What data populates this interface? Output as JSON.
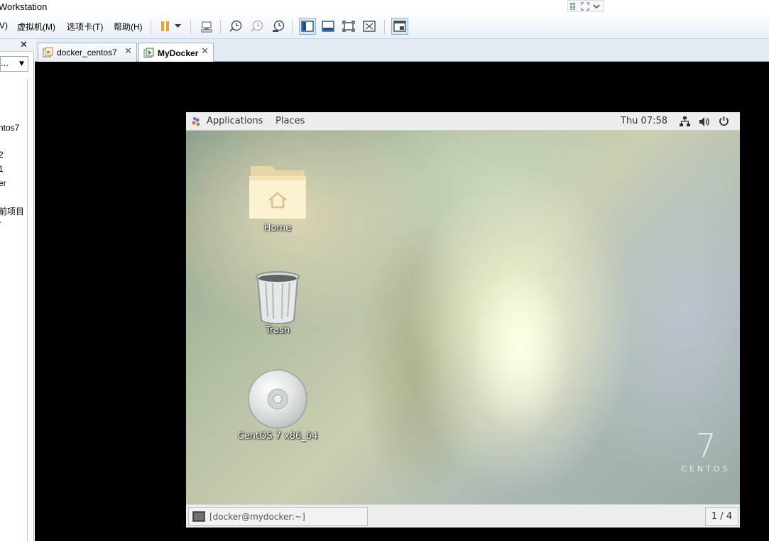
{
  "window": {
    "title": "Workstation"
  },
  "menu": {
    "items": [
      "V)",
      "虚拟机(M)",
      "选项卡(T)",
      "帮助(H)"
    ]
  },
  "toolbar": {
    "icons": [
      "pause-icon",
      "dropdown-arrow-icon",
      "send-ctrl-alt-del-icon",
      "snapshot-take-icon",
      "snapshot-revert-icon",
      "snapshot-manager-icon",
      "view-library-icon",
      "view-thumbnail-icon",
      "fullscreen-icon",
      "unity-icon",
      "console-view-icon"
    ],
    "pause_color": "#e8a23a"
  },
  "library": {
    "close_label": "✕",
    "search_value": "…",
    "tree_items": [
      "ntos7",
      "2",
      "1",
      "er",
      "前项目",
      "-"
    ]
  },
  "tabs": [
    {
      "label": "docker_centos7",
      "close": "✕",
      "active": false
    },
    {
      "label": "MyDocker",
      "close": "✕",
      "active": true
    }
  ],
  "guest": {
    "topbar": {
      "applications": "Applications",
      "places": "Places",
      "clock": "Thu 07:58"
    },
    "desktop_icons": [
      {
        "label": "Home",
        "icon": "home-folder-icon"
      },
      {
        "label": "Trash",
        "icon": "trash-icon"
      },
      {
        "label": "CentOS 7 x86_64",
        "icon": "optical-disc-icon"
      }
    ],
    "branding": {
      "number": "7",
      "word": "CENTOS"
    },
    "taskbar": {
      "terminal_label": "[docker@mydocker:~]",
      "workspace": "1 / 4"
    }
  }
}
